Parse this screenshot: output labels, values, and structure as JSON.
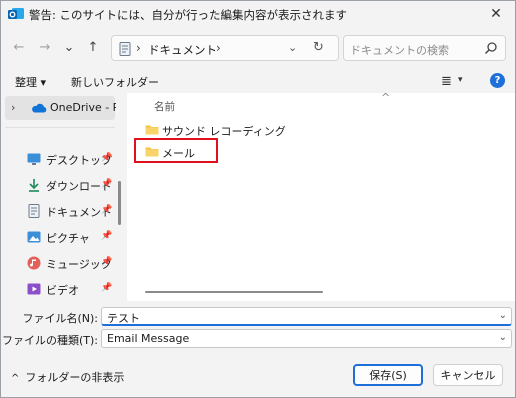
{
  "window": {
    "title": "警告: このサイトには、自分が行った編集内容が表示されます",
    "close_glyph": "✕"
  },
  "nav": {
    "back_glyph": "←",
    "forward_glyph": "→",
    "recent_glyph": "⌄",
    "up_glyph": "↑",
    "path_separator": "›",
    "path_current": "ドキュメント",
    "dropdown_glyph": "⌄",
    "refresh_glyph": "↻",
    "search_placeholder": "ドキュメントの検索"
  },
  "toolbar": {
    "organize_label": "整理 ▾",
    "new_folder_label": "新しいフォルダー",
    "view_glyph": "≣",
    "view_drop_glyph": "▾",
    "help_glyph": "?"
  },
  "sidebar": {
    "expand_glyph": "›",
    "onedrive_label": "OneDrive - Perso",
    "pin_glyph": "📌",
    "items": [
      {
        "label": "デスクトップ",
        "icon": "desktop-icon"
      },
      {
        "label": "ダウンロード",
        "icon": "download-icon"
      },
      {
        "label": "ドキュメント",
        "icon": "documents-icon"
      },
      {
        "label": "ピクチャ",
        "icon": "pictures-icon"
      },
      {
        "label": "ミュージック",
        "icon": "music-icon"
      },
      {
        "label": "ビデオ",
        "icon": "videos-icon"
      }
    ]
  },
  "content": {
    "column_name": "名前",
    "sort_glyph": "^",
    "folders": [
      {
        "label": "サウンド レコーディング"
      },
      {
        "label": "メール"
      }
    ]
  },
  "fields": {
    "filename_label": "ファイル名(N):",
    "filename_value": "テスト",
    "filetype_label": "ファイルの種類(T):",
    "filetype_value": "Email Message",
    "dropdown_glyph": "⌄"
  },
  "footer": {
    "hide_folders_glyph": "^",
    "hide_folders_label": "フォルダーの非表示",
    "save_label": "保存(S)",
    "cancel_label": "キャンセル"
  },
  "colors": {
    "accent": "#1e6fd9",
    "highlight": "#e0101c",
    "folder": "#f5c342"
  }
}
